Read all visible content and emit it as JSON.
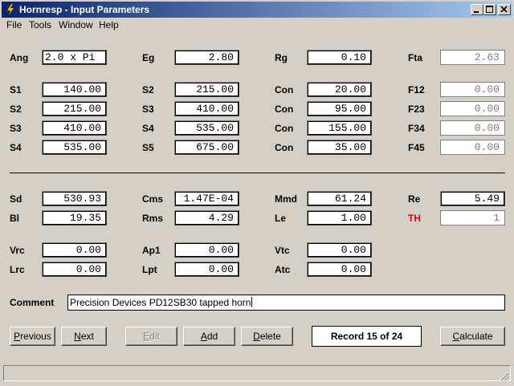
{
  "window": {
    "title": "Hornresp - Input Parameters"
  },
  "menu": [
    "File",
    "Tools",
    "Window",
    "Help"
  ],
  "params": [
    {
      "key": "ang",
      "label": "Ang",
      "value": "2.0 x Pi"
    },
    {
      "key": "eg",
      "label": "Eg",
      "value": "2.80"
    },
    {
      "key": "rg",
      "label": "Rg",
      "value": "0.10"
    },
    {
      "key": "fta",
      "label": "Fta",
      "value": "2.63"
    },
    {
      "key": "s1",
      "label": "S1",
      "value": "140.00"
    },
    {
      "key": "s2b",
      "label": "S2",
      "value": "215.00"
    },
    {
      "key": "con1",
      "label": "Con",
      "value": "20.00"
    },
    {
      "key": "f12",
      "label": "F12",
      "value": "0.00"
    },
    {
      "key": "s2",
      "label": "S2",
      "value": "215.00"
    },
    {
      "key": "s3b",
      "label": "S3",
      "value": "410.00"
    },
    {
      "key": "con2",
      "label": "Con",
      "value": "95.00"
    },
    {
      "key": "f23",
      "label": "F23",
      "value": "0.00"
    },
    {
      "key": "s3",
      "label": "S3",
      "value": "410.00"
    },
    {
      "key": "s4b",
      "label": "S4",
      "value": "535.00"
    },
    {
      "key": "con3",
      "label": "Con",
      "value": "155.00"
    },
    {
      "key": "f34",
      "label": "F34",
      "value": "0.00"
    },
    {
      "key": "s4",
      "label": "S4",
      "value": "535.00"
    },
    {
      "key": "s5",
      "label": "S5",
      "value": "675.00"
    },
    {
      "key": "con4",
      "label": "Con",
      "value": "35.00"
    },
    {
      "key": "f45",
      "label": "F45",
      "value": "0.00"
    },
    {
      "key": "sd",
      "label": "Sd",
      "value": "530.93"
    },
    {
      "key": "cms",
      "label": "Cms",
      "value": "1.47E-04"
    },
    {
      "key": "mmd",
      "label": "Mmd",
      "value": "61.24"
    },
    {
      "key": "re",
      "label": "Re",
      "value": "5.49"
    },
    {
      "key": "bl",
      "label": "Bl",
      "value": "19.35"
    },
    {
      "key": "rms",
      "label": "Rms",
      "value": "4.29"
    },
    {
      "key": "le",
      "label": "Le",
      "value": "1.00"
    },
    {
      "key": "th",
      "label": "TH",
      "value": "1"
    },
    {
      "key": "vrc",
      "label": "Vrc",
      "value": "0.00"
    },
    {
      "key": "ap1",
      "label": "Ap1",
      "value": "0.00"
    },
    {
      "key": "vtc",
      "label": "Vtc",
      "value": "0.00"
    },
    {
      "key": "lrc",
      "label": "Lrc",
      "value": "0.00"
    },
    {
      "key": "lpt",
      "label": "Lpt",
      "value": "0.00"
    },
    {
      "key": "atc",
      "label": "Atc",
      "value": "0.00"
    }
  ],
  "comment": {
    "label": "Comment",
    "value": "Precision Devices PD12SB30 tapped horn"
  },
  "buttons": {
    "previous": {
      "pre": "",
      "key": "P",
      "post": "revious"
    },
    "next": {
      "pre": "",
      "key": "N",
      "post": "ext"
    },
    "edit": {
      "pre": "",
      "key": "E",
      "post": "dit"
    },
    "add": {
      "pre": "",
      "key": "A",
      "post": "dd"
    },
    "delete": {
      "pre": "",
      "key": "D",
      "post": "elete"
    },
    "calculate": {
      "pre": "",
      "key": "C",
      "post": "alculate"
    }
  },
  "record": "Record 15 of 24",
  "colors": {
    "title_start": "#0a246a",
    "title_end": "#a6caf0",
    "th_label": "#e00000",
    "face": "#d4d0c8"
  }
}
